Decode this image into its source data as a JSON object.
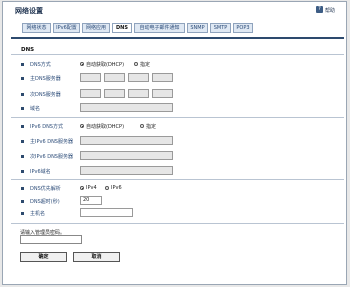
{
  "page": {
    "title": "网络设置",
    "help_label": "帮助",
    "help_icon": "help-icon"
  },
  "tabs": [
    {
      "label": "网络状态",
      "active": false
    },
    {
      "label": "IPv6配置",
      "active": false
    },
    {
      "label": "网络应用",
      "active": false
    },
    {
      "label": "DNS",
      "active": true
    },
    {
      "label": "自动电子邮件通知",
      "active": false
    },
    {
      "label": "SNMP",
      "active": false
    },
    {
      "label": "SMTP",
      "active": false
    },
    {
      "label": "POP3",
      "active": false
    }
  ],
  "section": {
    "title": "DNS"
  },
  "fields": {
    "dns_method": {
      "label": "DNS方式",
      "option_auto": "自动获取(DHCP)",
      "option_manual": "指定",
      "selected": "auto"
    },
    "primary_dns": {
      "label": "主DNS服务器"
    },
    "secondary_dns": {
      "label": "次DNS服务器"
    },
    "domain": {
      "label": "域名"
    },
    "ipv6_dns_method": {
      "label": "IPv6 DNS方式",
      "option_auto": "自动获取(DHCP)",
      "option_manual": "指定",
      "selected": "auto"
    },
    "ipv6_primary_dns": {
      "label": "主IPv6 DNS服务器"
    },
    "ipv6_secondary_dns": {
      "label": "次IPv6 DNS服务器"
    },
    "ipv6_domain": {
      "label": "IPv6域名"
    },
    "dns_priority": {
      "label": "DNS优先解析",
      "option_ipv4": "IPv4",
      "option_ipv6": "IPv6",
      "selected": "ipv4"
    },
    "dns_timeout": {
      "label": "DNS超时(秒)",
      "value": "20"
    },
    "host_name": {
      "label": "主机名",
      "value": ""
    }
  },
  "admin": {
    "prompt": "请输入管理员密码。",
    "password_value": ""
  },
  "buttons": {
    "ok": "确定",
    "cancel": "取消"
  }
}
